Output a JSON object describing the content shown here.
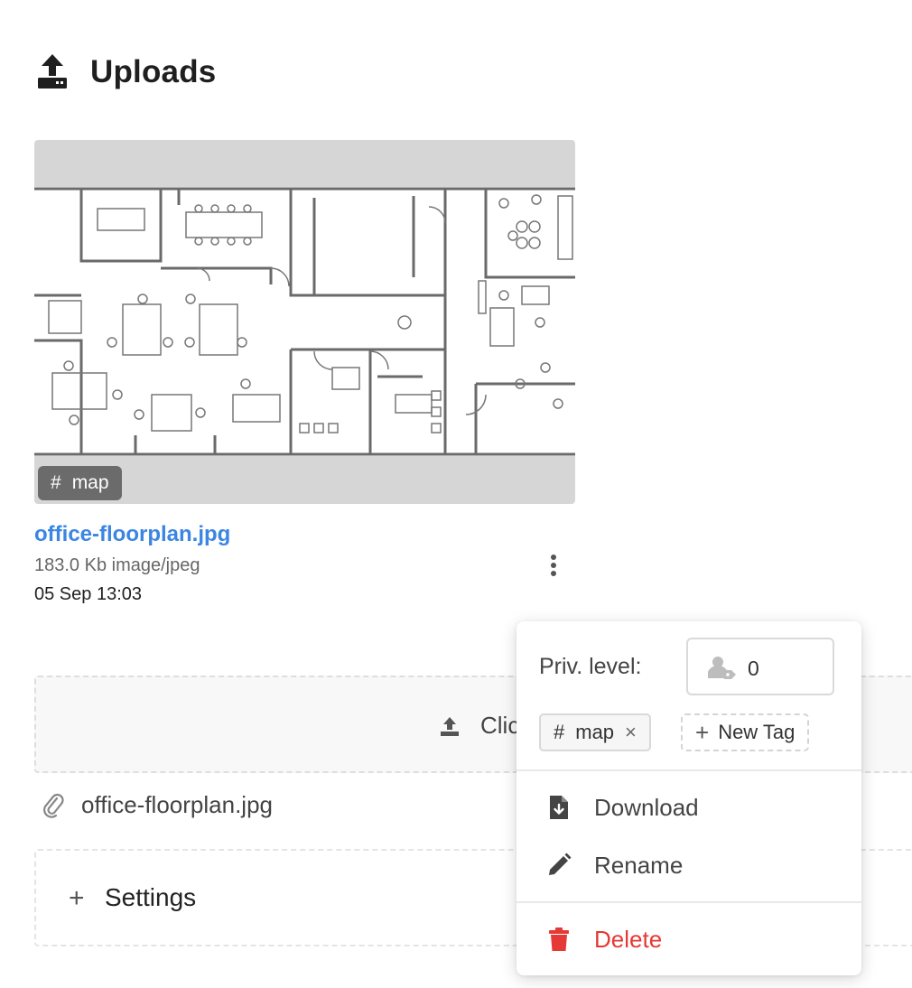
{
  "header": {
    "title": "Uploads",
    "icon": "upload-icon"
  },
  "card": {
    "tag": {
      "hash": "#",
      "label": "map"
    },
    "file_name": "office-floorplan.jpg",
    "meta": "183.0 Kb image/jpeg",
    "date": "05 Sep 13:03",
    "menu_icon": "more-vertical-icon"
  },
  "dropzone": {
    "icon": "upload-icon",
    "text": "Clic"
  },
  "attachment": {
    "icon": "paperclip-icon",
    "name": "office-floorplan.jpg"
  },
  "settings": {
    "plus": "+",
    "label": "Settings"
  },
  "menu": {
    "priv_label": "Priv. level:",
    "priv_value": "0",
    "priv_icon": "user-tag-icon",
    "tag": {
      "hash": "#",
      "label": "map",
      "close": "×"
    },
    "new_tag": {
      "plus": "+",
      "label": "New Tag"
    },
    "items": [
      {
        "label": "Download",
        "icon": "file-download-icon"
      },
      {
        "label": "Rename",
        "icon": "pencil-icon"
      }
    ],
    "delete": {
      "label": "Delete",
      "icon": "trash-icon"
    }
  },
  "colors": {
    "link": "#3a86e2",
    "danger": "#e53935",
    "tag_bg": "#6b6b6b",
    "thumb_bg": "#d6d6d6"
  }
}
